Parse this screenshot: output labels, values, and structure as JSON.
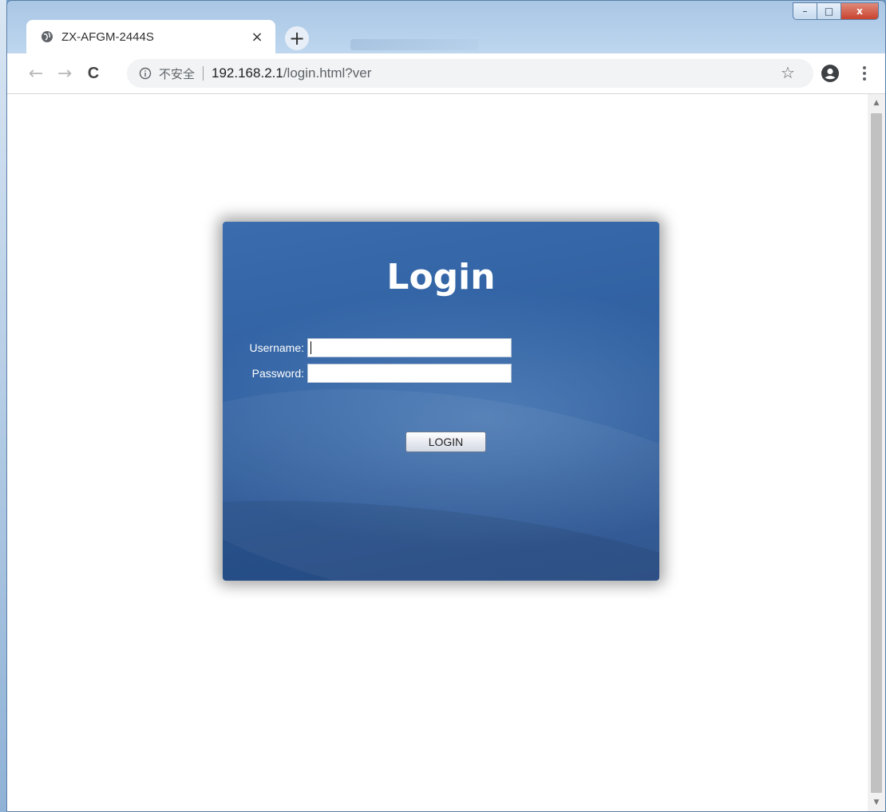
{
  "browser": {
    "tab": {
      "title": "ZX-AFGM-2444S",
      "close_symbol": "×",
      "favicon": "globe-icon"
    },
    "new_tab_symbol": "+",
    "window_controls": {
      "minimize": "–",
      "maximize": "□",
      "close": "x"
    },
    "toolbar": {
      "back_symbol": "←",
      "forward_symbol": "→",
      "reload_symbol": "C",
      "security_label": "不安全",
      "url_host": "192.168.2.1",
      "url_path": "/login.html?ver",
      "bookmark_symbol": "☆"
    }
  },
  "login": {
    "title": "Login",
    "username_label": "Username:",
    "username_value": "",
    "password_label": "Password:",
    "password_value": "",
    "button_label": "LOGIN"
  },
  "colors": {
    "panel_blue": "#2f5f9f",
    "window_frame": "#a9c6e4",
    "close_button": "#c8432f"
  }
}
